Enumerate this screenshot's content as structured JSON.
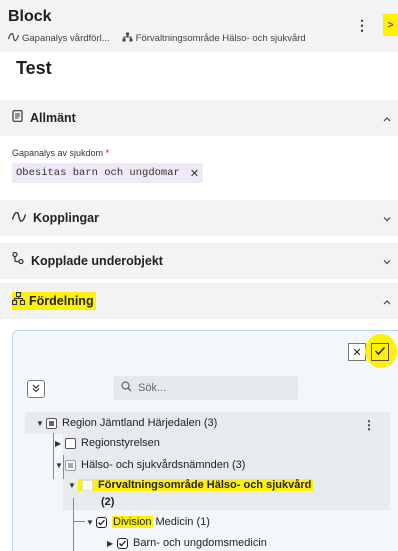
{
  "header": {
    "title": "Block",
    "breadcrumbs": [
      {
        "label": "Gapanalys vårdförl...",
        "icon": "wave-icon"
      },
      {
        "label": "Förvaltningsområde Hälso- och sjukvård",
        "icon": "hierarchy-icon"
      }
    ]
  },
  "page_title": "Test",
  "sections": {
    "allmant": {
      "label": "Allmänt",
      "expanded": true,
      "icon": "document-icon"
    },
    "kopplingar": {
      "label": "Kopplingar",
      "expanded": false,
      "icon": "wave-icon"
    },
    "kopplade": {
      "label": "Kopplade underobjekt",
      "expanded": false,
      "icon": "subobject-icon"
    },
    "fordelning": {
      "label": "Fördelning",
      "expanded": true,
      "icon": "hierarchy-icon"
    }
  },
  "field": {
    "label": "Gapanalys av sjukdom",
    "required_mark": "*",
    "chip_value": "Obesitas barn och ungdomar"
  },
  "search": {
    "placeholder": "Sök..."
  },
  "tree": {
    "region": "Region Jämtland Härjedalen (3)",
    "regionstyrelsen": "Regionstyrelsen",
    "namnd": "Hälso- och sjukvårdsnämnden (3)",
    "forvaltning": "Förvaltningsområde Hälso- och sjukvård",
    "forvaltning_count": "(2)",
    "division_word": "Division",
    "division_rest": "Medicin (1)",
    "barn": "Barn- och ungdomsmedicin"
  },
  "colors": {
    "highlight": "#fff200",
    "section_bg": "#f3f3f3",
    "chip_bg": "#efe8f7",
    "panel_bg": "#f3f7fb"
  }
}
